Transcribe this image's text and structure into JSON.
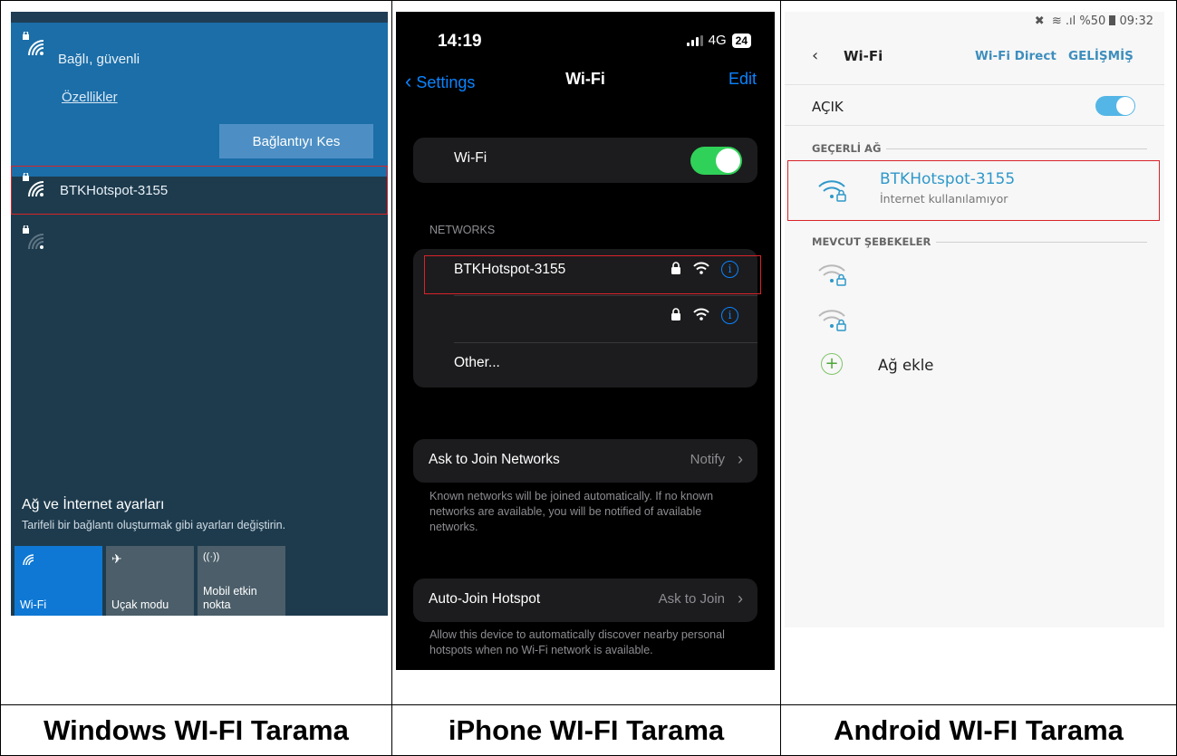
{
  "captions": {
    "windows": "Windows WI-FI Tarama",
    "iphone": "iPhone WI-FI Tarama",
    "android": "Android WI-FI Tarama"
  },
  "windows": {
    "connected_status": "Bağlı, güvenli",
    "properties_link": "Özellikler",
    "disconnect_button": "Bağlantıyı Kes",
    "networks": [
      {
        "name": "BTKHotspot-3155",
        "secured": true,
        "selected": true
      },
      {
        "name": "",
        "secured": true,
        "selected": false
      }
    ],
    "settings_title": "Ağ ve İnternet ayarları",
    "settings_subtitle": "Tarifeli bir bağlantı oluşturmak gibi ayarları değiştirin.",
    "tiles": [
      {
        "label": "Wi-Fi",
        "active": true,
        "icon": "wifi-icon"
      },
      {
        "label": "Uçak modu",
        "active": false,
        "icon": "airplane-icon"
      },
      {
        "label": "Mobil etkin nokta",
        "active": false,
        "icon": "hotspot-icon"
      }
    ],
    "accent_color": "#1b6ea8"
  },
  "iphone": {
    "time": "14:19",
    "network_type": "4G",
    "battery": "24",
    "back_label": "Settings",
    "title": "Wi-Fi",
    "edit_label": "Edit",
    "wifi_toggle_label": "Wi-Fi",
    "wifi_enabled": true,
    "networks_header": "NETWORKS",
    "networks": [
      {
        "name": "BTKHotspot-3155",
        "secured": true,
        "selected": true
      },
      {
        "name": "",
        "secured": true,
        "selected": false
      }
    ],
    "other_label": "Other...",
    "ask_join_label": "Ask to Join Networks",
    "ask_join_value": "Notify",
    "ask_join_note": "Known networks will be joined automatically. If no known networks are available, you will be notified of available networks.",
    "auto_join_label": "Auto-Join Hotspot",
    "auto_join_value": "Ask to Join",
    "auto_join_note": "Allow this device to automatically discover nearby personal hotspots when no Wi-Fi network is available.",
    "accent_color": "#0a84ff",
    "toggle_color": "#30d158"
  },
  "android": {
    "status_bar": "%50",
    "status_time": "09:32",
    "title": "Wi-Fi",
    "wifi_direct_label": "Wi-Fi Direct",
    "advanced_label": "GELİŞMİŞ",
    "toggle_label": "AÇIK",
    "wifi_enabled": true,
    "current_network_header": "GEÇERLİ AĞ",
    "current_network_name": "BTKHotspot-3155",
    "current_network_status": "İnternet kullanılamıyor",
    "available_header": "MEVCUT ŞEBEKELER",
    "available_networks": [
      {
        "name": "",
        "secured": true
      },
      {
        "name": "",
        "secured": true
      }
    ],
    "add_network_label": "Ağ ekle",
    "accent_color": "#2f98c9"
  },
  "highlight_color": "#d8232a"
}
